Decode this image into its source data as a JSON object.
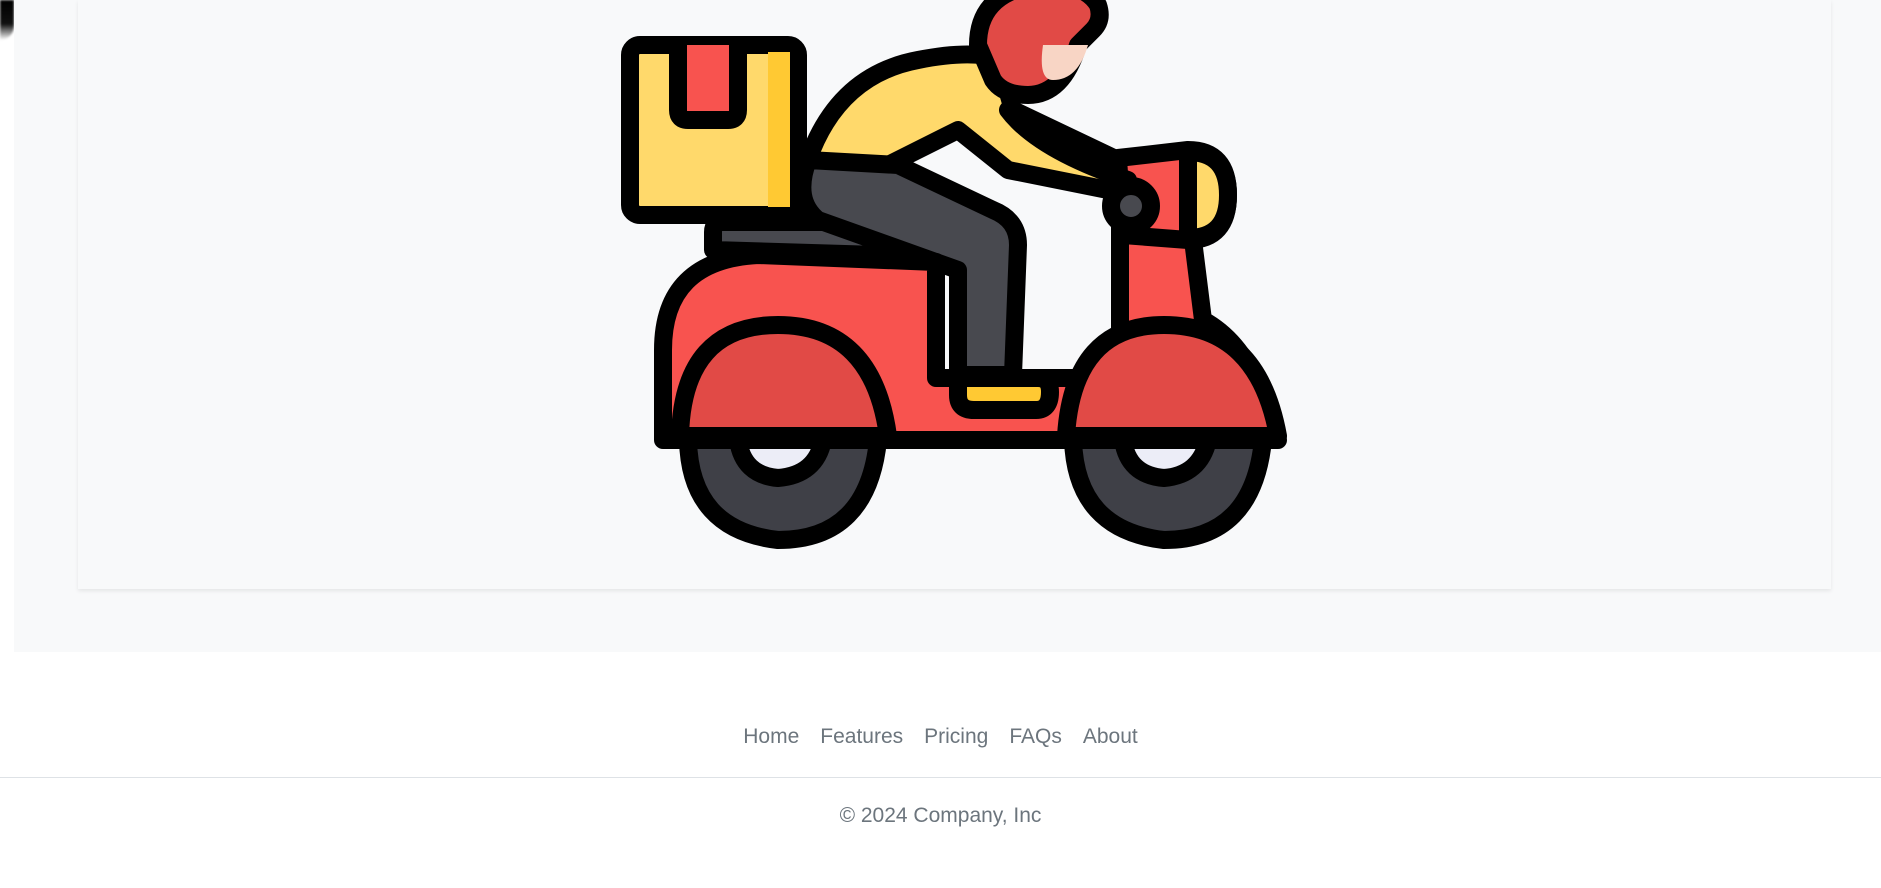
{
  "hero": {
    "image_icon": "delivery-scooter-icon"
  },
  "footer": {
    "nav": [
      {
        "label": "Home"
      },
      {
        "label": "Features"
      },
      {
        "label": "Pricing"
      },
      {
        "label": "FAQs"
      },
      {
        "label": "About"
      }
    ],
    "copyright": "© 2024 Company, Inc"
  },
  "colors": {
    "section_bg": "#f8f9fa",
    "link": "#6c757d",
    "divider": "#dee2e6",
    "scooter_red": "#f8534f",
    "scooter_dark_red": "#e14a46",
    "rider_yellow": "#ffd96b",
    "outline": "#000000",
    "pants": "#48494f"
  }
}
